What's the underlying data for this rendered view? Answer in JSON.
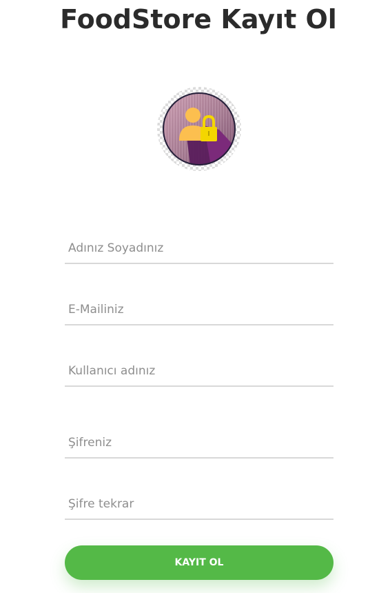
{
  "header": {
    "title": "FoodStore Kayıt Ol"
  },
  "avatar": {
    "icon": "user-lock-icon"
  },
  "form": {
    "fields": [
      {
        "name": "fullname-field",
        "placeholder": "Adınız Soyadınız",
        "value": ""
      },
      {
        "name": "email-field",
        "placeholder": "E-Mailiniz",
        "value": ""
      },
      {
        "name": "username-field",
        "placeholder": "Kullanıcı adınız",
        "value": ""
      },
      {
        "name": "password-field",
        "placeholder": "Şifreniz",
        "value": ""
      },
      {
        "name": "password-repeat-field",
        "placeholder": "Şifre tekrar",
        "value": ""
      }
    ],
    "submit_label": "KAYIT OL"
  },
  "colors": {
    "accent": "#54b947",
    "title": "#2b2b2b",
    "input_border": "#d8d8d8",
    "placeholder": "#8e8e8e",
    "avatar_purple": "#7b2a7a",
    "lock_yellow": "#f4d600"
  }
}
